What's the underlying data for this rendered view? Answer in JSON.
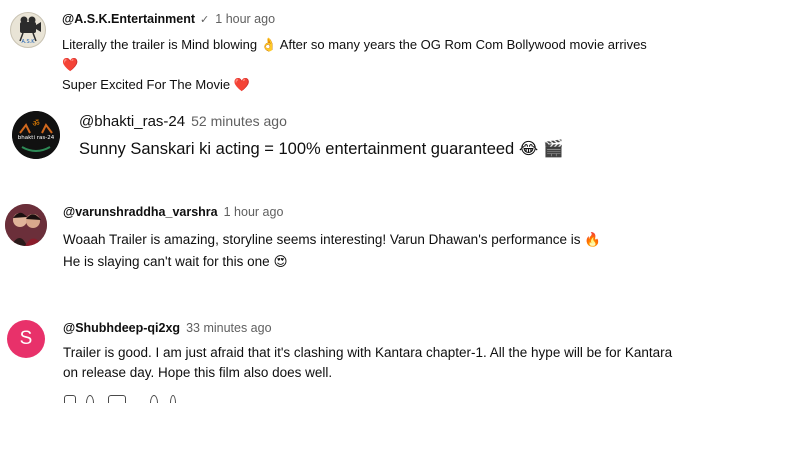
{
  "comments": [
    {
      "handle": "@A.S.K.Entertainment",
      "verified": true,
      "time": "1 hour ago",
      "avatar_text": "A.S.K",
      "lines": [
        [
          "Literally the trailer is Mind blowing ",
          "👌",
          " After so many years the OG Rom Com Bollywood movie arrives"
        ],
        [
          "❤️"
        ],
        [
          "Super Excited For The Movie ",
          "❤️"
        ]
      ]
    },
    {
      "handle": "@bhakti_ras-24",
      "time": "52 minutes ago",
      "avatar_text": "bhakti ras-24",
      "lines": [
        [
          "Sunny Sanskari ki acting = 100% entertainment guaranteed ",
          "😂 🎬"
        ]
      ]
    },
    {
      "handle": "@varunshraddha_varshra",
      "time": "1 hour ago",
      "lines": [
        [
          "Woaah Trailer is amazing, storyline seems interesting! Varun Dhawan's performance is ",
          "🔥"
        ],
        [
          "He is slaying can't wait for this one ",
          "😍"
        ]
      ]
    },
    {
      "handle": "@Shubhdeep-qi2xg",
      "time": "33 minutes ago",
      "avatar_letter": "S",
      "lines": [
        [
          "Trailer is good. I am just afraid that it's clashing with Kantara chapter-1. All the hype will be for Kantara"
        ],
        [
          "on release day. Hope this film also does well."
        ]
      ]
    }
  ],
  "colors": {
    "handle": "#0f0f0f",
    "time": "#606060",
    "avatar_s": "#e8316a"
  }
}
